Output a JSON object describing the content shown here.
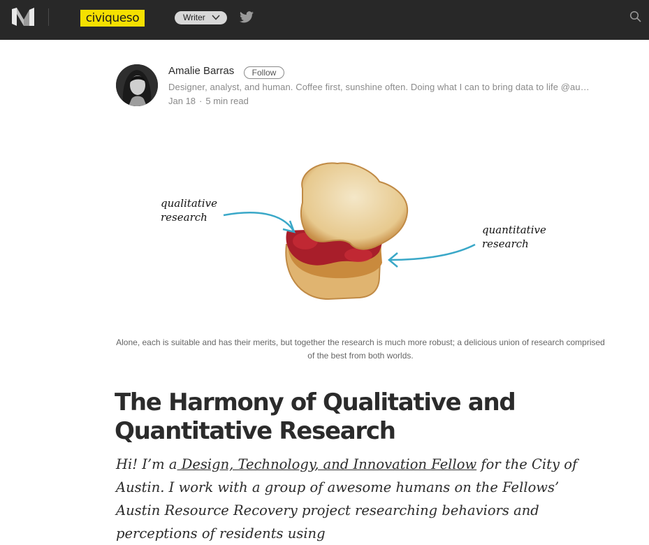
{
  "topbar": {
    "logo_icon": "medium-logo-icon",
    "publication": "civiqueso",
    "writer_label": "Writer",
    "twitter_icon": "twitter-icon",
    "search_icon": "search-icon",
    "colors": {
      "bar": "#282828",
      "publication_bg": "#f5e000"
    }
  },
  "author": {
    "name": "Amalie Barras",
    "follow_label": "Follow",
    "bio": "Designer, analyst, and human. Coffee first, sunshine often. Doing what I can to bring data to life @au…",
    "date": "Jan 18",
    "separator": "·",
    "read_time": "5 min read"
  },
  "figure": {
    "label_left_line1": "qualitative",
    "label_left_line2": "research",
    "label_right_line1": "quantitative",
    "label_right_line2": "research",
    "caption": "Alone, each is suitable and has their merits, but together the research is much more robust; a delicious union of research comprised of the best from both worlds.",
    "arrow_color": "#3aa8c8"
  },
  "article": {
    "title": "The Harmony of Qualitative and Quantitative Research",
    "intro_before": "Hi! I’m a",
    "intro_link": " Design, Technology, and Innovation Fellow",
    "intro_after": " for the City of Austin. I work with a group of awesome humans on the Fellows’ Austin Resource Recovery project researching behaviors and perceptions of residents using"
  }
}
